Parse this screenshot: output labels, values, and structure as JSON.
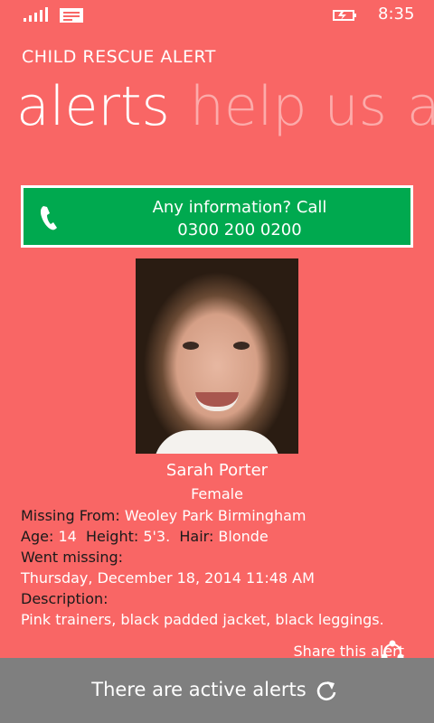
{
  "status": {
    "time": "8:35"
  },
  "app": {
    "title": "CHILD RESCUE ALERT"
  },
  "pivot": [
    "alerts",
    "help us",
    "ab"
  ],
  "call_banner": {
    "line1": "Any information? Call",
    "line2": "0300 200 0200"
  },
  "person": {
    "name": "Sarah Porter",
    "gender": "Female",
    "missing_from_label": "Missing From:",
    "missing_from": "Weoley Park Birmingham",
    "age_label": "Age:",
    "age": "14",
    "height_label": "Height:",
    "height": "5'3.",
    "hair_label": "Hair:",
    "hair": "Blonde",
    "went_missing_label": "Went missing:",
    "went_missing": "Thursday, December 18, 2014 11:48 AM",
    "description_label": "Description:",
    "description": "Pink trainers, black padded jacket, black leggings."
  },
  "share": {
    "label": "Share this alert"
  },
  "app_bar": {
    "label": "There are active alerts"
  },
  "colors": {
    "background": "#f96665",
    "call_banner": "#00a94f",
    "app_bar": "#7f7f7f"
  },
  "icons": [
    "signal-icon",
    "message-icon",
    "battery-icon",
    "phone-icon",
    "share-icon",
    "refresh-icon"
  ]
}
